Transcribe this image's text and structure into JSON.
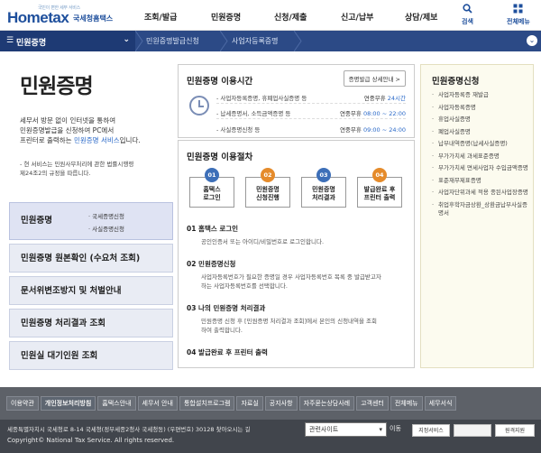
{
  "header": {
    "logo_tiny": "국민이 편한 세무 서비스",
    "logo_home": "Hometax",
    "logo_kr": "국세청홈택스",
    "menu": [
      "조회/발급",
      "민원증명",
      "신청/제출",
      "신고/납부",
      "상담/제보"
    ],
    "search_label": "검색",
    "allmenu_label": "전체메뉴"
  },
  "nav": {
    "home_label": "민원증명",
    "crumbs": [
      "민원증명발급신청",
      "사업자등록증명"
    ]
  },
  "intro": {
    "title": "민원증명",
    "desc_1": "세무서 방문 없이 인터넷을 통하여",
    "desc_2": "민원증명발급을 신청하여 PC에서",
    "desc_3_pre": "프린터로 출력하는 ",
    "desc_3_hl": "민원증명 서비스",
    "desc_3_post": "입니다.",
    "note_1": "- 현 서비스는 민원사무처리에 관한 법률시행령",
    "note_2": "제24조2의 규정을 따릅니다."
  },
  "sidemenu": {
    "first": "민원증명",
    "first_sub1": "· 국세증명신청",
    "first_sub2": "· 사실증명신청",
    "items": [
      "민원증명 원본확인 (수요처 조회)",
      "문서위변조방지 및 처벌안내",
      "민원증명 처리결과 조회",
      "민원실 대기인원 조회"
    ]
  },
  "hours": {
    "title": "민원증명 이용시간",
    "detail_button": "증명발급 상세안내 >",
    "rows": [
      {
        "label": "- 사업자등록증명, 휴폐업사실증명 등",
        "prefix": "연중무휴 ",
        "value": "24시간"
      },
      {
        "label": "- 납세증명서, 소득금액증명 등",
        "prefix": "연중무휴 ",
        "value": "08:00 ~ 22:00"
      },
      {
        "label": "- 사실증명신청 등",
        "prefix": "연중무휴 ",
        "value": "09:00 ~ 24:00"
      }
    ]
  },
  "procedure": {
    "title": "민원증명 이용절차",
    "steps": [
      {
        "num": "01",
        "line1": "홈택스",
        "line2": "로그인",
        "color": "#3d6fb8"
      },
      {
        "num": "02",
        "line1": "민원증명",
        "line2": "신청진행",
        "color": "#e58b2b"
      },
      {
        "num": "03",
        "line1": "민원증명",
        "line2": "처리결과",
        "color": "#3d6fb8"
      },
      {
        "num": "04",
        "line1": "발급완료 후",
        "line2": "프린터 출력",
        "color": "#e58b2b"
      }
    ],
    "items": [
      {
        "title": "01  홈택스 로그인",
        "desc1": "공인인증서 또는 아이디/비밀번호로 로그인합니다.",
        "desc2": ""
      },
      {
        "title": "02  민원증명신청",
        "desc1": "사업자등록번호가 필요한 증명일 경우 사업자등록번호 목록 중 발급받고자",
        "desc2": "하는 사업자등록번호를 선택합니다."
      },
      {
        "title": "03  나의 민원증명 처리결과",
        "desc1": "민원증명 신청 후 [민원증명 처리결과 조회]에서 본인의 신청내역을 조회",
        "desc2": "하여 출력합니다."
      },
      {
        "title": "04  발급완료 후 프린터 출력",
        "desc1": "",
        "desc2": ""
      }
    ]
  },
  "apps": {
    "title": "민원증명신청",
    "items": [
      "사업자등록증 재발급",
      "사업자등록증명",
      "휴업사실증명",
      "폐업사실증명",
      "납부내역증명(납세사실증명)",
      "부가가치세 과세표준증명",
      "부가가치세 면세사업자 수입금액증명",
      "표준재무제표증명",
      "사업자단위과세 적용 종된사업장증명",
      "취업후학자금상환_상환금납부사실증명서"
    ]
  },
  "footer": {
    "links": [
      "이용약관",
      "개인정보처리방침",
      "홈택스안내",
      "세무서 안내",
      "통합설치프로그램",
      "자료실",
      "공지사항",
      "자주묻는상담사례",
      "고객센터",
      "전체메뉴",
      "세무서식"
    ],
    "address": "세종특별자치시 국세청로 8-14 국세청(정부세종2청사 국세청동) (우편번호) 30128   찾아오시는 길",
    "copyright": "Copyright© National Tax Service. All rights reserved.",
    "related_select": "관련사이트",
    "go_label": "이동",
    "badge1": "지정서비스",
    "badge2": "원격지원"
  },
  "colors": {
    "brand": "#1e4f9c",
    "nav": "#2c4a86",
    "step_blue": "#3d6fb8",
    "step_orange": "#e58b2b",
    "accent_text": "#2968c8"
  }
}
